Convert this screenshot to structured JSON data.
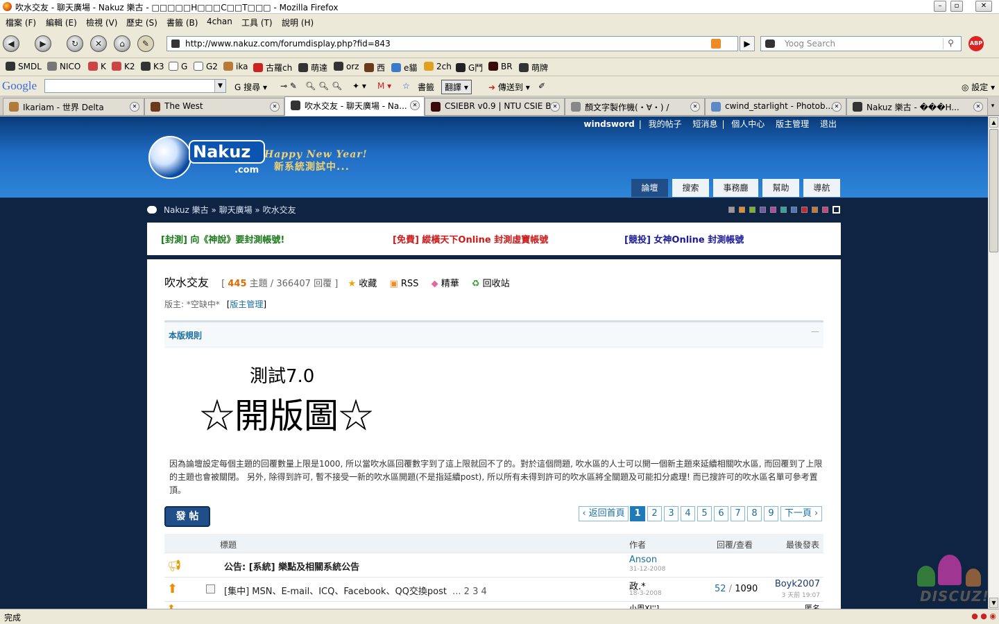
{
  "window": {
    "title": "吹水交友 - 聊天廣場 - Nakuz 樂古 - □□□□□H□□□C□□T□□□ - Mozilla Firefox"
  },
  "menu": [
    "檔案 (F)",
    "編輯 (E)",
    "檢視 (V)",
    "歷史 (S)",
    "書籤 (B)",
    "4chan",
    "工具 (T)",
    "說明 (H)"
  ],
  "url": "http://www.nakuz.com/forumdisplay.php?fid=843",
  "search_placeholder": "Yoog Search",
  "bookmarks": [
    "SMDL",
    "NICO",
    "K",
    "K2",
    "K3",
    "G",
    "G2",
    "ika",
    "古羅ch",
    "萌達",
    "orz",
    "西",
    "e貓",
    "2ch",
    "G鬥",
    "BR",
    "萌牌"
  ],
  "google": {
    "logo": "Google",
    "items": [
      "搜尋",
      "書籤",
      "翻譯",
      "傳送到",
      "設定"
    ]
  },
  "tabs": [
    {
      "label": "Ikariam - 世界 Delta",
      "active": false
    },
    {
      "label": "The West",
      "active": false
    },
    {
      "label": "吹水交友 - 聊天廣場 - Na...",
      "active": true
    },
    {
      "label": "CSIEBR v0.9 | NTU CSIE B...",
      "active": false
    },
    {
      "label": "顏文字製作機(・∀・) /",
      "active": false
    },
    {
      "label": "cwind_starlight - Photob...",
      "active": false
    },
    {
      "label": "Nakuz 樂古 - ���H...",
      "active": false
    }
  ],
  "site": {
    "user": "windsword",
    "toplinks": [
      "我的帖子",
      "短消息",
      "個人中心",
      "版主管理",
      "退出"
    ],
    "logo_text": "Nakuz",
    "logo_sub": ".com",
    "slogan1": "Happy New Year!",
    "slogan2": "新系統測試中...",
    "navtabs": [
      "論壇",
      "搜索",
      "事務廳",
      "幫助",
      "導航"
    ],
    "breadcrumb": "Nakuz 樂古 » 聊天廣場 » 吹水交友",
    "swatches": [
      "#9a9a9a",
      "#e68b2c",
      "#7bb32e",
      "#6b5aa8",
      "#b04aa0",
      "#2aa8a0",
      "#4a78b8",
      "#c8282c",
      "#c87838",
      "#d0407c",
      "#ffffff"
    ]
  },
  "ads": [
    {
      "text": "[封測] 向《神說》要封測帳號!",
      "color": "#1a7a1a"
    },
    {
      "text": "[免費] 縱橫天下Online 封測虛寶帳號",
      "color": "#cc1a1a"
    },
    {
      "text": "[競投] 女神Online 封測帳號",
      "color": "#1a1a9a"
    }
  ],
  "forum": {
    "name": "吹水交友",
    "topics": "445",
    "topics_label": "主題",
    "replies": "366407",
    "replies_label": "回覆",
    "actions": [
      "收藏",
      "RSS",
      "精華",
      "回收站"
    ],
    "moderator": "版主: *空缺中*",
    "mod_link": "版主管理",
    "rules_title": "本版規則",
    "banner_small": "測試7.0",
    "banner_big": "☆開版圖☆",
    "rules_text": "因為論壇設定每個主題的回覆數量上限是1000, 所以當吹水區回覆數字到了這上限就回不了的。對於這個問題, 吹水區的人士可以開一個新主題來延續相關吹水區, 而回覆到了上限的主題也會被關閉。 另外, 除得到許可, 暫不接受一新的吹水區開題(不是指延續post), 所以所有未得到許可的吹水區將全關題及可能扣分處理! 而已搜許可的吹水區名單可參考置頂。",
    "post_btn": "發 帖"
  },
  "pagination": {
    "back": "返回首頁",
    "pages": [
      "1",
      "2",
      "3",
      "4",
      "5",
      "6",
      "7",
      "8",
      "9"
    ],
    "next": "下一頁"
  },
  "table": {
    "headers": [
      "標題",
      "作者",
      "回覆/查看",
      "最後發表"
    ],
    "rows": [
      {
        "title": "公告: [系統] 樂點及相關系統公告",
        "author": "Anson",
        "date": "31-12-2008",
        "replies": "",
        "views": "",
        "last": "",
        "last_date": ""
      },
      {
        "title": "[集中] MSN、E-mail、ICQ、Facebook、QQ交換post",
        "pages": "... 2 3 4",
        "author": "政.*",
        "date": "18-3-2008",
        "replies": "52",
        "views": "1090",
        "last": "Boyk2007",
        "last_date": "3 天前 19:07"
      },
      {
        "title": "",
        "author": "小周XI'']",
        "date": "",
        "replies": "",
        "views": "",
        "last": "匿名",
        "last_date": ""
      }
    ]
  },
  "status": "完成",
  "watermark": "DISCUZ!"
}
